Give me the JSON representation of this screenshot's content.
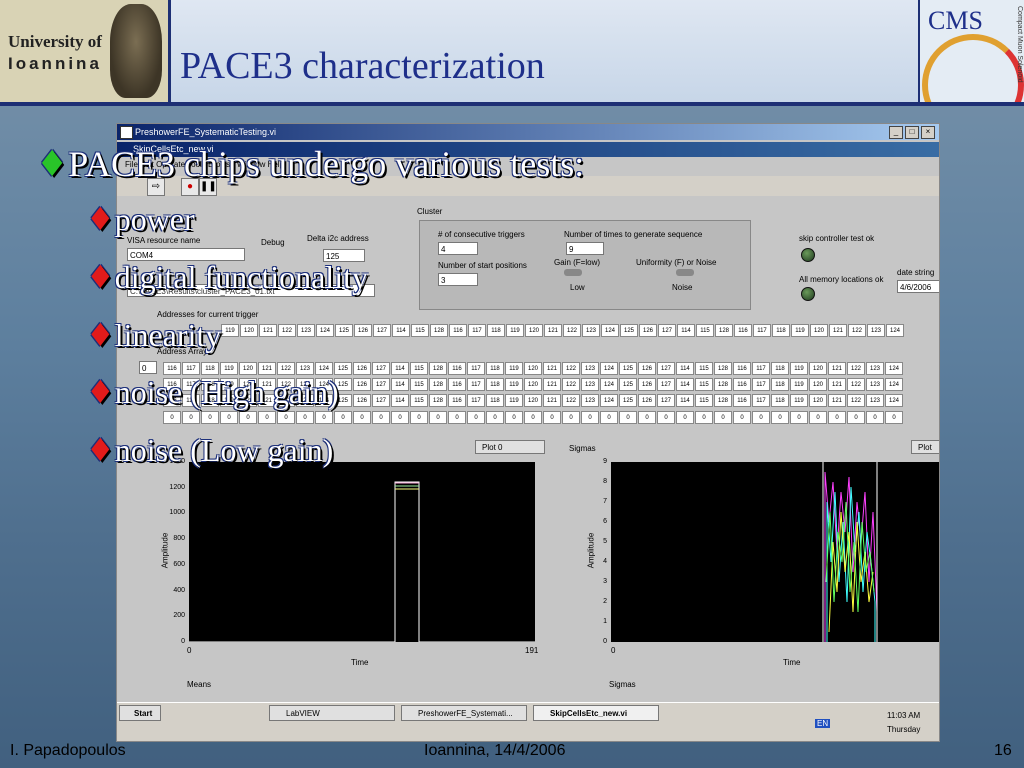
{
  "slide": {
    "title": "PACE3 characterization",
    "logo_left_line1": "University of",
    "logo_left_line2": "Ioannina",
    "logo_right_text": "CMS",
    "logo_right_vertical": "Compact Muon Solenoid"
  },
  "bullets": {
    "main": "PACE3 chips undergo various tests:",
    "items": [
      "power",
      "digital functionality",
      "linearity",
      "noise (High gain)",
      "noise (Low gain)"
    ]
  },
  "footer": {
    "author": "I. Papadopoulos",
    "place_date": "Ioannina, 14/4/2006",
    "page": "16"
  },
  "app": {
    "window_title": "PreshowerFE_SystematicTesting.vi",
    "inner_title": "SkipCellsEtc_new.vi",
    "menu": "File  Edit  Operate  Tools  Browse  Window  Help",
    "visa_label": "VISA resource name",
    "visa_value": "COM4",
    "debug_label": "Debug",
    "delta_label": "Delta i2c address",
    "delta_value": "125",
    "path_value": "C:\\PACE3\\Results\\cluster_PACE3_01.txt",
    "cluster_label": "Cluster",
    "consec_label": "# of consecutive triggers",
    "consec_value": "4",
    "times_label": "Number of times to generate sequence",
    "times_value": "9",
    "start_label": "Number of start positions",
    "start_value": "3",
    "gain_label": "Gain (F=low)",
    "gain_value": "Low",
    "uniform_label": "Uniformity (F) or Noise",
    "uniform_value": "Noise",
    "skip_label": "skip controller test ok",
    "mem_label": "All memory locations ok",
    "date_label": "date string",
    "date_value": "4/6/2006",
    "addr_label": "Addresses for current trigger",
    "array_label": "Address Array",
    "array_index": "0",
    "row1": [
      "119",
      "120",
      "121",
      "122",
      "123",
      "124",
      "125",
      "126",
      "127",
      "114",
      "115",
      "128",
      "116",
      "117",
      "118",
      "119",
      "120",
      "121",
      "122",
      "123",
      "124",
      "125",
      "126",
      "127",
      "114",
      "115",
      "128",
      "116",
      "117",
      "118",
      "119",
      "120",
      "121",
      "122",
      "123",
      "124"
    ],
    "row2": [
      "116",
      "117",
      "118",
      "119",
      "120",
      "121",
      "122",
      "123",
      "124",
      "125",
      "126",
      "127",
      "114",
      "115",
      "128",
      "116",
      "117",
      "118",
      "119",
      "120",
      "121",
      "122",
      "123",
      "124",
      "125",
      "126",
      "127",
      "114",
      "115",
      "128",
      "116",
      "117",
      "118",
      "119",
      "120",
      "121",
      "122",
      "123",
      "124"
    ],
    "row4": [
      "0",
      "0",
      "0",
      "0",
      "0",
      "0",
      "0",
      "0",
      "0",
      "0",
      "0",
      "0",
      "0",
      "0",
      "0",
      "0",
      "0",
      "0",
      "0",
      "0",
      "0",
      "0",
      "0",
      "0",
      "0",
      "0",
      "0",
      "0",
      "0",
      "0",
      "0",
      "0",
      "0",
      "0",
      "0",
      "0",
      "0",
      "0",
      "0"
    ],
    "plot1_legend": "Plot 0",
    "plot1_ylabel": "Amplitude",
    "plot1_xlabel": "Time",
    "plot1_yticks": [
      "1300",
      "1200",
      "1000",
      "800",
      "600",
      "400",
      "200",
      "0"
    ],
    "plot1_xmin": "0",
    "plot1_xmax": "191",
    "plot2_title": "Sigmas",
    "plot2_legend": "Plot",
    "plot2_ylabel": "Amplitude",
    "plot2_xlabel": "Time",
    "plot2_yticks": [
      "9",
      "8",
      "7",
      "6",
      "5",
      "4",
      "3",
      "2",
      "1",
      "0"
    ],
    "plot2_xmin": "0",
    "means_label": "Means",
    "sigmas_label": "Sigmas",
    "means_value": "0",
    "sigmas_value": "0"
  },
  "taskbar": {
    "start": "Start",
    "items": [
      "LabVIEW",
      "PreshowerFE_Systemati...",
      "SkipCellsEtc_new.vi"
    ],
    "lang": "EN",
    "time": "11:03 AM",
    "day": "Thursday"
  },
  "colors": {
    "title": "#1e2f8a",
    "header_band": "#1d2f74",
    "bullet_main": "#29c429",
    "bullet_sub": "#e21b1b"
  }
}
